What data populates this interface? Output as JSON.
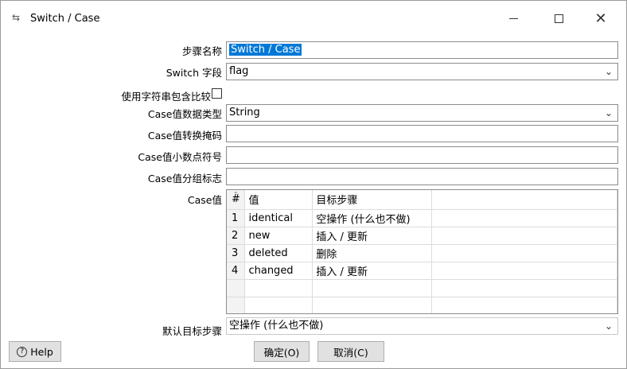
{
  "window": {
    "title": "Switch / Case",
    "icon": "swap-arrows-icon"
  },
  "form": {
    "step_name_label": "步骤名称",
    "step_name_value": "Switch / Case",
    "switch_field_label": "Switch 字段",
    "switch_field_value": "flag",
    "contains_compare_label": "使用字符串包含比较",
    "contains_compare_checked": false,
    "case_type_label": "Case值数据类型",
    "case_type_value": "String",
    "case_mask_label": "Case值转换掩码",
    "case_mask_value": "",
    "case_decimal_label": "Case值小数点符号",
    "case_decimal_value": "",
    "case_group_label": "Case值分组标志",
    "case_group_value": "",
    "case_values_label": "Case值",
    "default_target_label": "默认目标步骤",
    "default_target_value": "空操作 (什么也不做)"
  },
  "grid": {
    "columns": [
      "#",
      "值",
      "目标步骤",
      ""
    ],
    "rows": [
      {
        "num": "1",
        "value": "identical",
        "target": "空操作 (什么也不做)"
      },
      {
        "num": "2",
        "value": "new",
        "target": "插入 / 更新"
      },
      {
        "num": "3",
        "value": "deleted",
        "target": "删除"
      },
      {
        "num": "4",
        "value": "changed",
        "target": "插入 / 更新"
      }
    ]
  },
  "buttons": {
    "help": "Help",
    "ok": "确定(O)",
    "cancel": "取消(C)"
  }
}
